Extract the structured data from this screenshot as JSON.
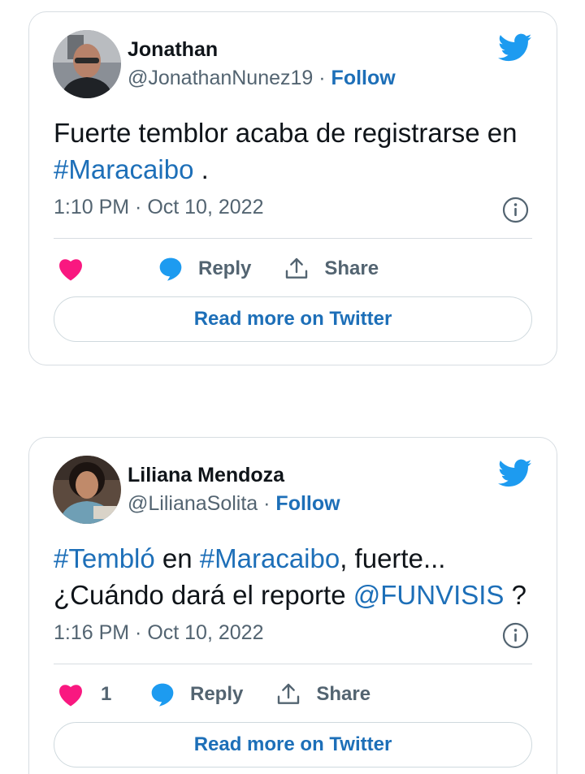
{
  "colors": {
    "link": "#1d6fb8",
    "like": "#f91880",
    "twitter_blue": "#1d9bf0",
    "muted": "#536471"
  },
  "tweets": [
    {
      "display_name": "Jonathan",
      "handle": "@JonathanNunez19",
      "separator": " · ",
      "follow": "Follow",
      "text": {
        "part1": "Fuerte temblor acaba de registrarse en ",
        "hashtag1": "#Maracaibo",
        "part2": " ."
      },
      "timestamp": "1:10 PM · Oct 10, 2022",
      "like_count": "",
      "reply_label": "Reply",
      "share_label": "Share",
      "read_more": "Read more on Twitter",
      "icons": [
        "heart-icon",
        "reply-bubble-icon",
        "share-icon",
        "twitter-bird-icon",
        "info-icon"
      ]
    },
    {
      "display_name": "Liliana Mendoza",
      "handle": "@LilianaSolita",
      "separator": " · ",
      "follow": "Follow",
      "text": {
        "hashtag1": "#Tembló",
        "part1": " en ",
        "hashtag2": "#Maracaibo",
        "part2": ", fuerte... ¿Cuándo dará el reporte ",
        "mention": "@FUNVISIS",
        "part3": " ?"
      },
      "timestamp": "1:16 PM · Oct 10, 2022",
      "like_count": "1",
      "reply_label": "Reply",
      "share_label": "Share",
      "read_more": "Read more on Twitter",
      "icons": [
        "heart-icon",
        "reply-bubble-icon",
        "share-icon",
        "twitter-bird-icon",
        "info-icon"
      ]
    }
  ]
}
